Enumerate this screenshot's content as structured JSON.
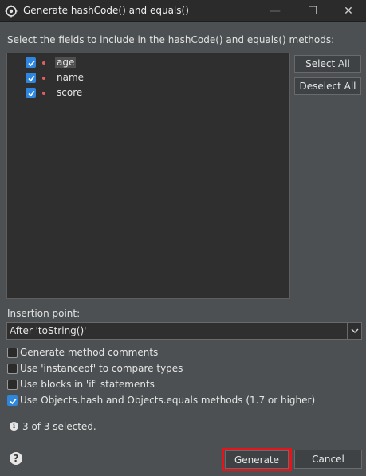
{
  "window": {
    "title": "Generate hashCode() and equals()",
    "icon": "eclipse-icon",
    "minimize_glyph": "—",
    "maximize_glyph": "☐",
    "close_glyph": "✕"
  },
  "instruction": "Select the fields to include in the hashCode() and equals() methods:",
  "fields": [
    {
      "name": "age",
      "checked": true,
      "highlighted": true
    },
    {
      "name": "name",
      "checked": true,
      "highlighted": false
    },
    {
      "name": "score",
      "checked": true,
      "highlighted": false
    }
  ],
  "buttons": {
    "select_all": "Select All",
    "deselect_all": "Deselect All",
    "generate": "Generate",
    "cancel": "Cancel"
  },
  "insertion_point": {
    "label": "Insertion point:",
    "value": "After 'toString()'"
  },
  "options": [
    {
      "label": "Generate method comments",
      "checked": false
    },
    {
      "label": "Use 'instanceof' to compare types",
      "checked": false
    },
    {
      "label": "Use blocks in 'if' statements",
      "checked": false
    },
    {
      "label": "Use Objects.hash and Objects.equals methods (1.7 or higher)",
      "checked": true
    }
  ],
  "status": "3 of 3 selected.",
  "help_glyph": "?",
  "colors": {
    "accent": "#2e86de",
    "highlight_border": "#e3141b",
    "background": "#4c5052"
  }
}
